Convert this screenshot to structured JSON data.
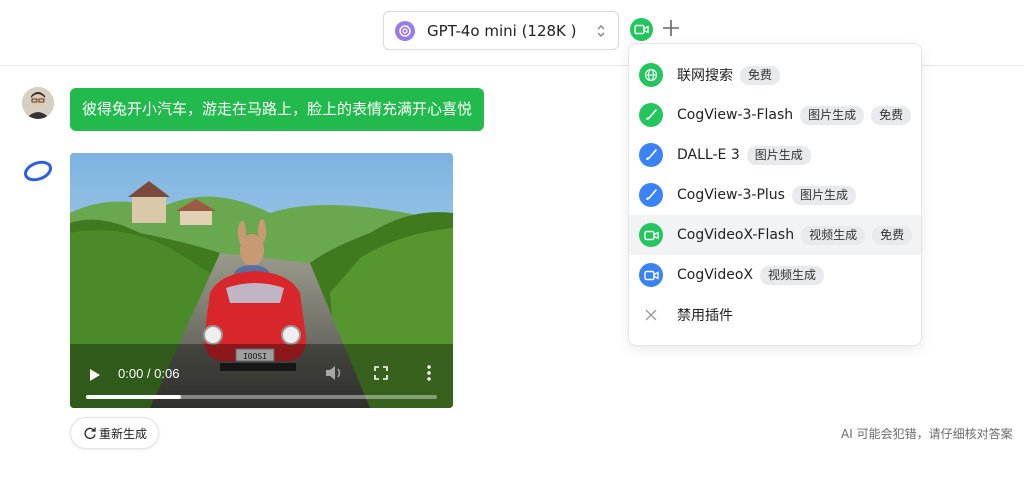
{
  "header": {
    "model_name": "GPT-4o mini (128K )",
    "model_icon": "openai-icon",
    "active_plugin_icon": "video-icon",
    "add_icon": "plus-icon"
  },
  "conversation": {
    "user_message": "彼得兔开小汽车，游走在马路上，脸上的表情充满开心喜悦",
    "video": {
      "time": "0:00 / 0:06",
      "progress": 0.27,
      "plate_text": "IOOSI"
    },
    "regenerate_label": "重新生成",
    "disclaimer": "AI 可能会犯错，请仔细核对答案"
  },
  "plugin_menu": {
    "items": [
      {
        "label": "联网搜索",
        "tags": [
          "免费"
        ],
        "icon": "globe-icon",
        "color": "#22c55e"
      },
      {
        "label": "CogView-3-Flash",
        "tags": [
          "图片生成",
          "免费"
        ],
        "icon": "brush-icon",
        "color": "#22c55e"
      },
      {
        "label": "DALL-E 3",
        "tags": [
          "图片生成"
        ],
        "icon": "brush-icon",
        "color": "#3b82f6"
      },
      {
        "label": "CogView-3-Plus",
        "tags": [
          "图片生成"
        ],
        "icon": "brush-icon",
        "color": "#3b82f6"
      },
      {
        "label": "CogVideoX-Flash",
        "tags": [
          "视频生成",
          "免费"
        ],
        "icon": "video-icon",
        "color": "#22c55e"
      },
      {
        "label": "CogVideoX",
        "tags": [
          "视频生成"
        ],
        "icon": "video-icon",
        "color": "#3b82f6"
      },
      {
        "label": "禁用插件",
        "tags": [],
        "icon": "close-icon",
        "color": "#999999"
      }
    ]
  },
  "colors": {
    "accent_green": "#22c55e",
    "user_bubble": "#22b94d",
    "accent_blue": "#3b82f6"
  }
}
